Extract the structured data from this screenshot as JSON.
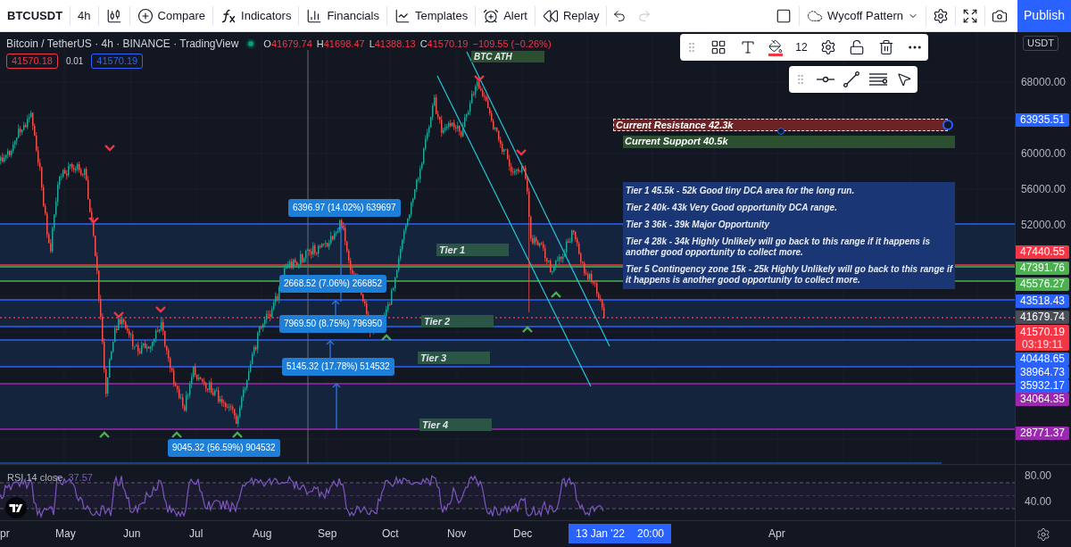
{
  "toolbar": {
    "symbol": "BTCUSDT",
    "interval": "4h",
    "buttons": [
      {
        "label": "Compare"
      },
      {
        "label": "Indicators"
      },
      {
        "label": "Financials"
      },
      {
        "label": "Templates"
      },
      {
        "label": "Alert"
      },
      {
        "label": "Replay"
      }
    ],
    "undo": {
      "disabled": false
    },
    "redo": {
      "disabled": true
    },
    "layout_name": "Wycoff Pattern",
    "publish": "Publish"
  },
  "legend": {
    "title": "Bitcoin / TetherUS · 4h · BINANCE · TradingView",
    "ohlc": [
      {
        "label": "O",
        "value": "41679.74"
      },
      {
        "label": "H",
        "value": "41698.47"
      },
      {
        "label": "L",
        "value": "41388.13"
      },
      {
        "label": "C",
        "value": "41570.19"
      }
    ],
    "change": "−109.55 (−0.26%)",
    "sell": "41570.18",
    "spread": "0.01",
    "buy": "41570.19"
  },
  "drawing_toolbar": {
    "font_size": "12"
  },
  "drawings": {
    "ath_label": "BTC ATH",
    "tiers": [
      "Tier 1",
      "Tier 2",
      "Tier 3",
      "Tier 4"
    ],
    "measurements": [
      "6396.97 (14.02%) 639697",
      "2668.52 (7.06%) 266852",
      "7969.50 (8.75%) 796950",
      "5145.32 (17.78%) 514532",
      "9045.32 (56.59%) 904532"
    ],
    "annotations": [
      {
        "kind": "resistance",
        "text": "Current Resistance 42.3k",
        "selected": true
      },
      {
        "kind": "support",
        "text": "Current Support 40.5k",
        "selected": false
      }
    ],
    "notes": [
      "Tier 1 45.5k - 52k Good tiny DCA area for the long run.",
      "Tier 2 40k- 43k Very Good opportunity DCA range.",
      "Tier 3 36k - 39k Major Opportunity",
      "Tier 4 28k - 34k Highly Unlikely will go back to this range if it happens is another good opportunity to collect more.",
      "Tier 5 Contingency zone 15k - 25k Highly Unlikely will go back to this range if it happens is another good opportunity to collect more."
    ]
  },
  "price_axis": {
    "currency": "USDT",
    "ticks": [
      "68000.00",
      "60000.00",
      "56000.00",
      "52000.00"
    ],
    "labels": [
      {
        "value": "63935.51",
        "color": "#2962ff"
      },
      {
        "value": "47440.55",
        "color": "#f23645"
      },
      {
        "value": "47391.76",
        "color": "#4caf50"
      },
      {
        "value": "45576.27",
        "color": "#4caf50"
      },
      {
        "value": "43518.43",
        "color": "#2962ff"
      },
      {
        "value": "41679.74",
        "color": "#4a4e59"
      },
      {
        "value": "41570.19",
        "countdown": "03:19:11",
        "color": "#f23645"
      },
      {
        "value": "40448.65",
        "color": "#2962ff"
      },
      {
        "value": "38964.73",
        "color": "#2962ff"
      },
      {
        "value": "35932.17",
        "color": "#2962ff"
      },
      {
        "value": "34064.35",
        "color": "#9c27b0"
      },
      {
        "value": "28771.37",
        "color": "#9c27b0"
      }
    ]
  },
  "rsi": {
    "title": "RSI 14 close",
    "value": "37.57",
    "ticks": [
      "80.00",
      "40.00"
    ]
  },
  "time_axis": {
    "labels": [
      "pr",
      "May",
      "Jun",
      "Jul",
      "Aug",
      "Sep",
      "Oct",
      "Nov",
      "Dec",
      "Apr"
    ],
    "cursor": {
      "date": "13 Jan '22",
      "time": "20:00"
    }
  }
}
